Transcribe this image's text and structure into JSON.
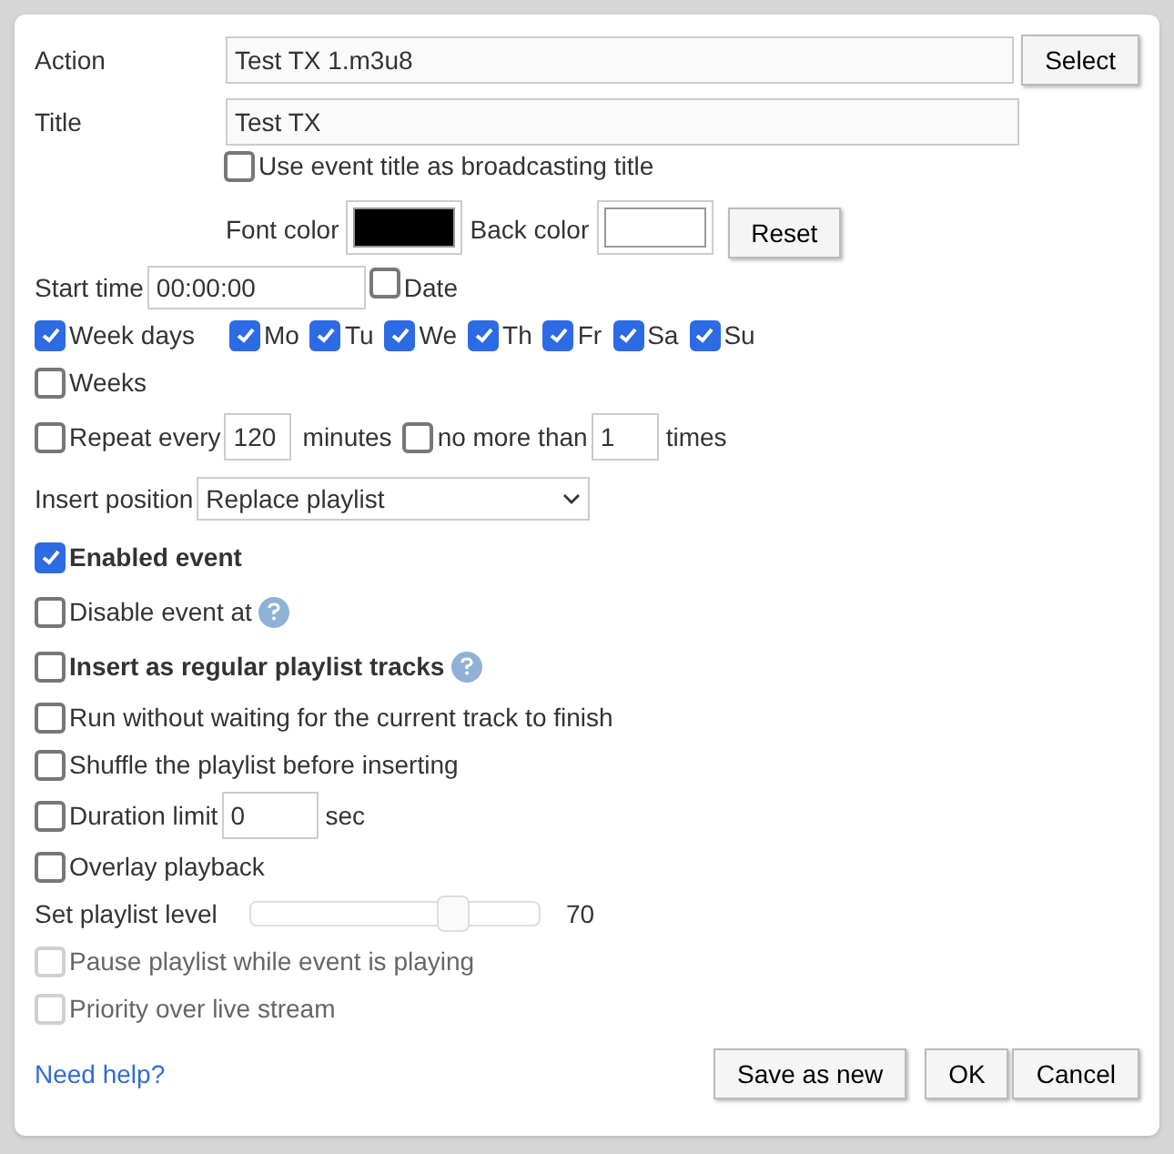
{
  "fields": [
    {
      "label": "Action",
      "value": "Test TX 1.m3u8",
      "button": "Select"
    },
    {
      "label": "Title",
      "value": "Test TX"
    }
  ],
  "use_title": {
    "label": "Use event title as broadcasting title",
    "checked": false
  },
  "colors": [
    {
      "label": "Font color",
      "color": "#000000"
    },
    {
      "label": "Back color",
      "color": "#ffffff"
    }
  ],
  "reset": "Reset",
  "start_time": {
    "label": "Start time",
    "value": "00:00:00"
  },
  "date": {
    "label": "Date",
    "checked": false
  },
  "week_days": {
    "label": "Week days",
    "checked": true,
    "days": [
      {
        "label": "Mo",
        "checked": true
      },
      {
        "label": "Tu",
        "checked": true
      },
      {
        "label": "We",
        "checked": true
      },
      {
        "label": "Th",
        "checked": true
      },
      {
        "label": "Fr",
        "checked": true
      },
      {
        "label": "Sa",
        "checked": true
      },
      {
        "label": "Su",
        "checked": true
      }
    ]
  },
  "weeks": {
    "label": "Weeks",
    "checked": false
  },
  "repeat": {
    "label": "Repeat every",
    "checked": false,
    "value": "120",
    "unit": "minutes",
    "limit": {
      "label": "no more than",
      "checked": false,
      "value": "1",
      "unit": "times"
    }
  },
  "insert_position": {
    "label": "Insert position",
    "value": "Replace playlist"
  },
  "options": [
    {
      "kind": "check",
      "label": "Enabled event",
      "checked": true,
      "bold": true,
      "help": false,
      "disabled": false
    },
    {
      "kind": "check",
      "label": "Disable event at",
      "checked": false,
      "bold": false,
      "help": true,
      "disabled": false
    },
    {
      "kind": "check",
      "label": "Insert as regular playlist tracks",
      "checked": false,
      "bold": true,
      "help": true,
      "disabled": false
    },
    {
      "kind": "check",
      "label": "Run without waiting for the current track to finish",
      "checked": false,
      "bold": false,
      "help": false,
      "disabled": false
    },
    {
      "kind": "check",
      "label": "Shuffle the playlist before inserting",
      "checked": false,
      "bold": false,
      "help": false,
      "disabled": false
    },
    {
      "kind": "duration",
      "label": "Duration limit",
      "checked": false,
      "value": "0",
      "unit": "sec"
    },
    {
      "kind": "check",
      "label": "Overlay playback",
      "checked": false,
      "bold": false,
      "help": false,
      "disabled": false
    },
    {
      "kind": "slider",
      "label": "Set playlist level",
      "level": 0.7,
      "reading": "70"
    },
    {
      "kind": "check",
      "label": "Pause playlist while event is playing",
      "checked": false,
      "bold": false,
      "help": false,
      "disabled": true
    },
    {
      "kind": "check",
      "label": "Priority over live stream",
      "checked": false,
      "bold": false,
      "help": false,
      "disabled": true
    }
  ],
  "help_link": "Need help?",
  "buttons": [
    "Save as new",
    "OK",
    "Cancel"
  ]
}
